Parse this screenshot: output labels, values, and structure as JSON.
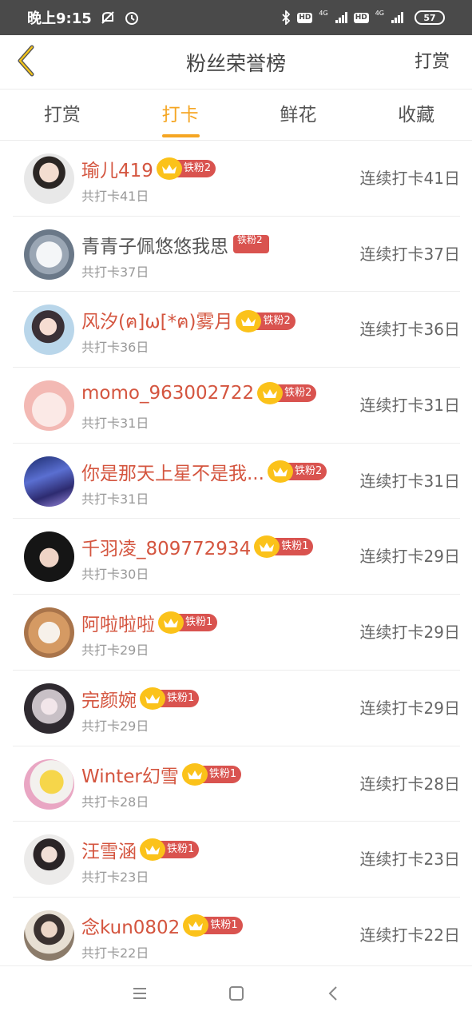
{
  "status_bar": {
    "time": "晚上9:15",
    "network_left": "4G",
    "network_right": "4G",
    "hd_left": "HD",
    "hd_right": "HD",
    "battery": "57",
    "icons": [
      "mute-icon",
      "alarm-icon",
      "bluetooth-icon",
      "signal-icon",
      "battery-icon"
    ]
  },
  "header": {
    "title": "粉丝荣誉榜",
    "action": "打赏",
    "back_icon": "chevron-left-icon",
    "accent": "#f5a623"
  },
  "tabs": [
    {
      "label": "打赏",
      "active": false
    },
    {
      "label": "打卡",
      "active": true
    },
    {
      "label": "鲜花",
      "active": false
    },
    {
      "label": "收藏",
      "active": false
    }
  ],
  "list": [
    {
      "name": "瑜儿419",
      "badge": "铁粉2",
      "total": "共打卡41日",
      "streak": "连续打卡41日"
    },
    {
      "name": "青青子佩悠悠我思",
      "badge": "铁粉2",
      "total": "共打卡37日",
      "streak": "连续打卡37日"
    },
    {
      "name": "风汐(ฅ]ω[*ฅ)雾月",
      "badge": "铁粉2",
      "total": "共打卡36日",
      "streak": "连续打卡36日"
    },
    {
      "name": "momo_963002722",
      "badge": "铁粉2",
      "total": "共打卡31日",
      "streak": "连续打卡31日"
    },
    {
      "name": "你是那天上星不是我...",
      "badge": "铁粉2",
      "total": "共打卡31日",
      "streak": "连续打卡31日"
    },
    {
      "name": "千羽凌_809772934",
      "badge": "铁粉1",
      "total": "共打卡30日",
      "streak": "连续打卡29日"
    },
    {
      "name": "阿啦啦啦",
      "badge": "铁粉1",
      "total": "共打卡29日",
      "streak": "连续打卡29日"
    },
    {
      "name": "完颜婉",
      "badge": "铁粉1",
      "total": "共打卡29日",
      "streak": "连续打卡29日"
    },
    {
      "name": "Winter幻雪",
      "badge": "铁粉1",
      "total": "共打卡28日",
      "streak": "连续打卡28日"
    },
    {
      "name": "汪雪涵",
      "badge": "铁粉1",
      "total": "共打卡23日",
      "streak": "连续打卡23日"
    },
    {
      "name": "念kun0802",
      "badge": "铁粉1",
      "total": "共打卡22日",
      "streak": "连续打卡22日"
    }
  ],
  "colors": {
    "name": "#d4553f",
    "badge_bg": "#d9534f",
    "crown": "#fbc21a"
  },
  "nav": [
    "menu-icon",
    "home-icon",
    "back-icon"
  ]
}
